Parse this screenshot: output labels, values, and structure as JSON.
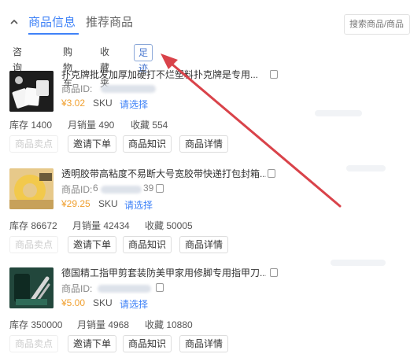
{
  "header": {
    "collapse_icon": "chevron-up-icon",
    "tabs": [
      {
        "label": "商品信息",
        "active": true
      },
      {
        "label": "推荐商品",
        "active": false
      }
    ],
    "search_placeholder": "搜索商品/商品ID"
  },
  "subtabs": [
    {
      "label": "咨询商品",
      "active": false
    },
    {
      "label": "购物车",
      "active": false
    },
    {
      "label": "收藏夹",
      "active": false
    },
    {
      "label": "足迹",
      "active": true
    }
  ],
  "products": [
    {
      "title": "扑克牌批发加厚加硬打不烂塑料扑克牌是专用...",
      "id_label": "商品ID:",
      "id_value": "",
      "price": "¥3.02",
      "sku_label": "SKU",
      "select_label": "请选择",
      "stats": {
        "stock": "库存 1400",
        "monthly_sales": "月销量 490",
        "favorites": "收藏 554"
      },
      "buttons": [
        "商品卖点",
        "邀请下单",
        "商品知识",
        "商品详情"
      ]
    },
    {
      "title": "透明胶带高粘度不易断大号宽胶带快递打包封箱...",
      "id_label": "商品ID:",
      "id_value": "6",
      "id_suffix": "39",
      "price": "¥29.25",
      "sku_label": "SKU",
      "select_label": "请选择",
      "stats": {
        "stock": "库存 86672",
        "monthly_sales": "月销量 42434",
        "favorites": "收藏 50005"
      },
      "buttons": [
        "商品卖点",
        "邀请下单",
        "商品知识",
        "商品详情"
      ]
    },
    {
      "title": "德国精工指甲剪套装防美甲家用修脚专用指甲刀...",
      "id_label": "商品ID:",
      "id_value": "",
      "price": "¥5.00",
      "sku_label": "SKU",
      "select_label": "请选择",
      "stats": {
        "stock": "库存 350000",
        "monthly_sales": "月销量 4968",
        "favorites": "收藏 10880"
      },
      "buttons": [
        "商品卖点",
        "邀请下单",
        "商品知识",
        "商品详情"
      ]
    }
  ],
  "colors": {
    "accent": "#3f82f7",
    "price": "#f0a030",
    "arrow": "#d9434a"
  }
}
